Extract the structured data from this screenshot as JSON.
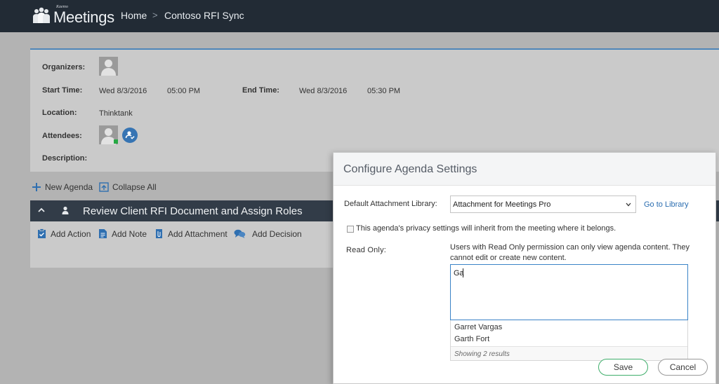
{
  "header": {
    "logo_small": "Kaemo",
    "logo_text": "Meetings",
    "nav_home": "Home",
    "nav_separator": ">",
    "nav_site": "Contoso RFI Sync"
  },
  "meeting": {
    "organizers_label": "Organizers:",
    "start_label": "Start Time:",
    "start_date": "Wed 8/3/2016",
    "start_time": "05:00 PM",
    "end_label": "End Time:",
    "end_date": "Wed 8/3/2016",
    "end_time": "05:30 PM",
    "location_label": "Location:",
    "location_value": "Thinktank",
    "attendees_label": "Attendees:",
    "description_label": "Description:"
  },
  "toolbar": {
    "new_agenda": "New Agenda",
    "collapse_all": "Collapse All"
  },
  "agenda": {
    "title": "Review Client RFI Document and Assign Roles",
    "actions": [
      "Add Action",
      "Add Note",
      "Add Attachment",
      "Add Decision"
    ]
  },
  "modal": {
    "title": "Configure Agenda Settings",
    "default_lib_label": "Default Attachment Library:",
    "default_lib_value": "Attachment for Meetings Pro",
    "go_to_library": "Go to Library",
    "privacy_text": "This agenda's privacy settings will inherit from the meeting where it belongs.",
    "privacy_checked": false,
    "read_only_label": "Read Only:",
    "read_only_desc": "Users with Read Only permission can only view agenda content. They cannot edit or create new content.",
    "people_input_value": "Ga",
    "suggestions": [
      "Garret Vargas",
      "Garth Fort"
    ],
    "suggestions_footer": "Showing 2 results",
    "save_label": "Save",
    "cancel_label": "Cancel"
  },
  "colors": {
    "topbar": "#222b35",
    "accent_blue": "#3674b3",
    "save_border": "#3fae6b",
    "presence_green": "#27a844"
  }
}
